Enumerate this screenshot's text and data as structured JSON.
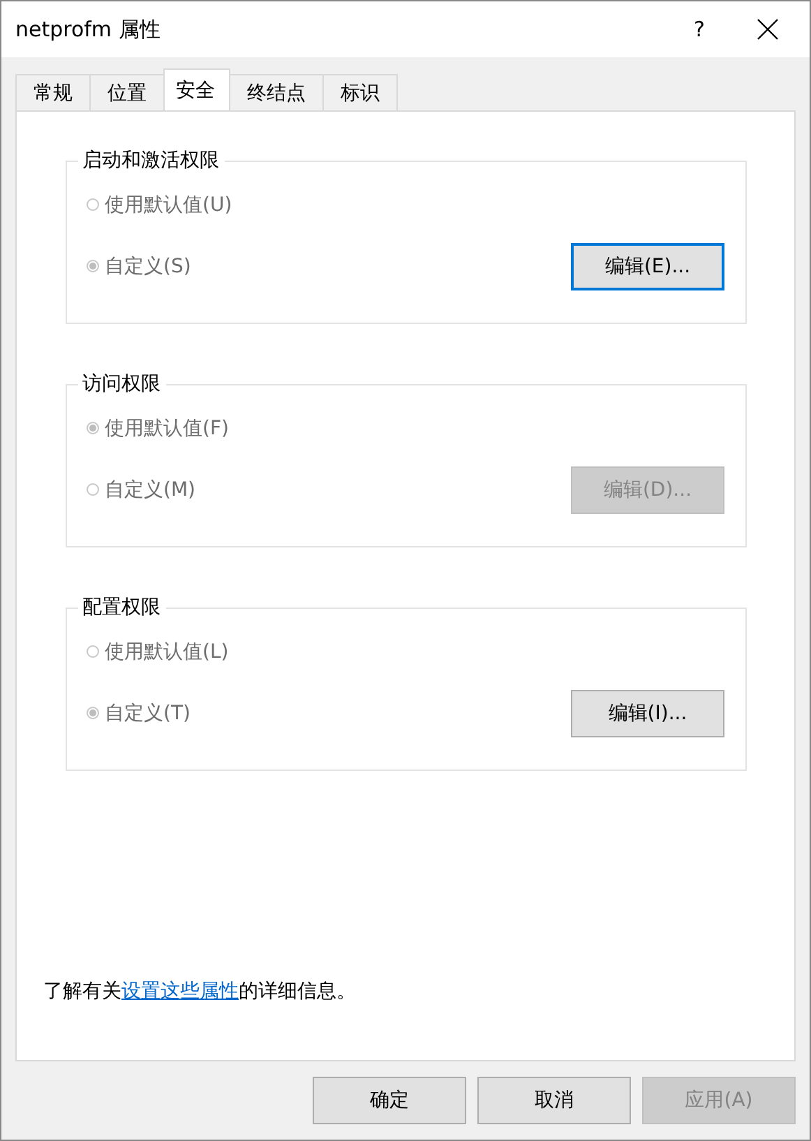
{
  "window": {
    "title": "netprofm 属性",
    "help": "?"
  },
  "tabs": [
    {
      "label": "常规",
      "selected": false
    },
    {
      "label": "位置",
      "selected": false
    },
    {
      "label": "安全",
      "selected": true
    },
    {
      "label": "终结点",
      "selected": false
    },
    {
      "label": "标识",
      "selected": false
    }
  ],
  "groups": [
    {
      "title": "启动和激活权限",
      "options": [
        {
          "label": "使用默认值(U)",
          "selected": false,
          "disabled": true
        },
        {
          "label": "自定义(S)",
          "selected": true,
          "disabled": true
        }
      ],
      "edit_button": {
        "label": "编辑(E)...",
        "disabled": false,
        "focused": true
      }
    },
    {
      "title": "访问权限",
      "options": [
        {
          "label": "使用默认值(F)",
          "selected": true,
          "disabled": true
        },
        {
          "label": "自定义(M)",
          "selected": false,
          "disabled": true
        }
      ],
      "edit_button": {
        "label": "编辑(D)...",
        "disabled": true,
        "focused": false
      }
    },
    {
      "title": "配置权限",
      "options": [
        {
          "label": "使用默认值(L)",
          "selected": false,
          "disabled": true
        },
        {
          "label": "自定义(T)",
          "selected": true,
          "disabled": true
        }
      ],
      "edit_button": {
        "label": "编辑(I)...",
        "disabled": false,
        "focused": false
      }
    }
  ],
  "info": {
    "prefix": "了解有关",
    "link": "设置这些属性",
    "suffix": "的详细信息。"
  },
  "buttons": [
    {
      "label": "确定",
      "disabled": false
    },
    {
      "label": "取消",
      "disabled": false
    },
    {
      "label": "应用(A)",
      "disabled": true
    }
  ]
}
